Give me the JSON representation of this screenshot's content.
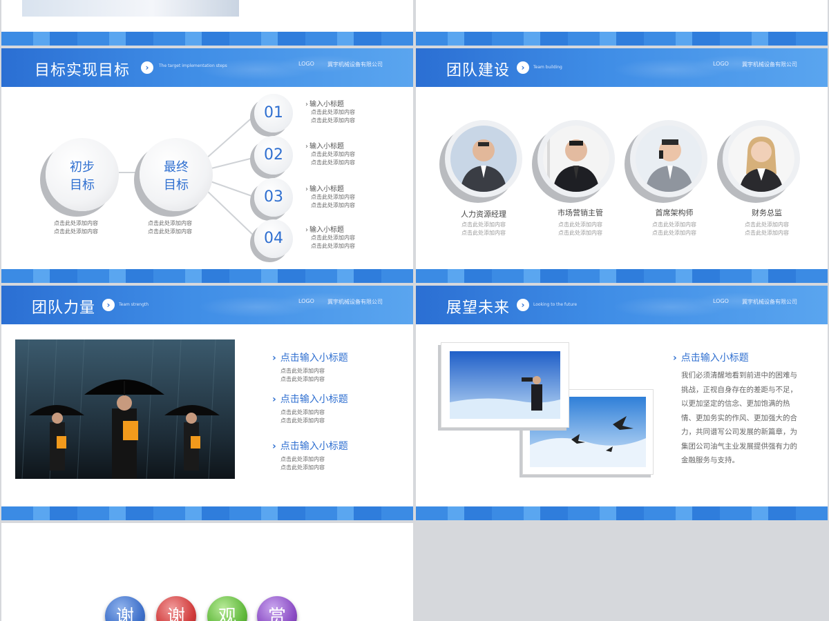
{
  "slides": {
    "goal": {
      "title": "目标实现目标",
      "subtitle": "The target implementation steps",
      "logo": "LOGO",
      "company": "冀宇机械设备有限公司",
      "left_circles": [
        {
          "label_line1": "初步",
          "label_line2": "目标",
          "desc1": "点击此处添加内容",
          "desc2": "点击此处添加内容"
        },
        {
          "label_line1": "最终",
          "label_line2": "目标",
          "desc1": "点击此处添加内容",
          "desc2": "点击此处添加内容"
        }
      ],
      "items": [
        {
          "num": "01",
          "title": "输入小标题",
          "d1": "点击此处添加内容",
          "d2": "点击此处添加内容"
        },
        {
          "num": "02",
          "title": "输入小标题",
          "d1": "点击此处添加内容",
          "d2": "点击此处添加内容"
        },
        {
          "num": "03",
          "title": "输入小标题",
          "d1": "点击此处添加内容",
          "d2": "点击此处添加内容"
        },
        {
          "num": "04",
          "title": "输入小标题",
          "d1": "点击此处添加内容",
          "d2": "点击此处添加内容"
        }
      ]
    },
    "team": {
      "title": "团队建设",
      "subtitle": "Team building",
      "logo": "LOGO",
      "company": "冀宇机械设备有限公司",
      "members": [
        {
          "role": "人力资源经理",
          "d1": "点击此处添加内容",
          "d2": "点击此处添加内容"
        },
        {
          "role": "市场营销主管",
          "d1": "点击此处添加内容",
          "d2": "点击此处添加内容"
        },
        {
          "role": "首席架构师",
          "d1": "点击此处添加内容",
          "d2": "点击此处添加内容"
        },
        {
          "role": "财务总监",
          "d1": "点击此处添加内容",
          "d2": "点击此处添加内容"
        }
      ]
    },
    "strength": {
      "title": "团队力量",
      "subtitle": "Team strength",
      "logo": "LOGO",
      "company": "冀宇机械设备有限公司",
      "items": [
        {
          "title": "点击输入小标题",
          "d1": "点击此处添加内容",
          "d2": "点击此处添加内容"
        },
        {
          "title": "点击输入小标题",
          "d1": "点击此处添加内容",
          "d2": "点击此处添加内容"
        },
        {
          "title": "点击输入小标题",
          "d1": "点击此处添加内容",
          "d2": "点击此处添加内容"
        }
      ]
    },
    "future": {
      "title": "展望未来",
      "subtitle": "Looking to the future",
      "logo": "LOGO",
      "company": "冀宇机械设备有限公司",
      "heading": "点击输入小标题",
      "paragraph": "我们必须清醒地看到前进中的困难与挑战，正视自身存在的差距与不足，以更加坚定的信念、更加饱满的热情、更加务实的作风、更加强大的合力，共同谱写公司发展的新篇章，为集团公司油气主业发展提供强有力的金融服务与支持。"
    },
    "thanks": {
      "chars": [
        "谢",
        "谢",
        "观",
        "赏"
      ],
      "colors": [
        "#3d6fc9",
        "#d03a3a",
        "#5fb83a",
        "#8a4bc4"
      ]
    }
  }
}
